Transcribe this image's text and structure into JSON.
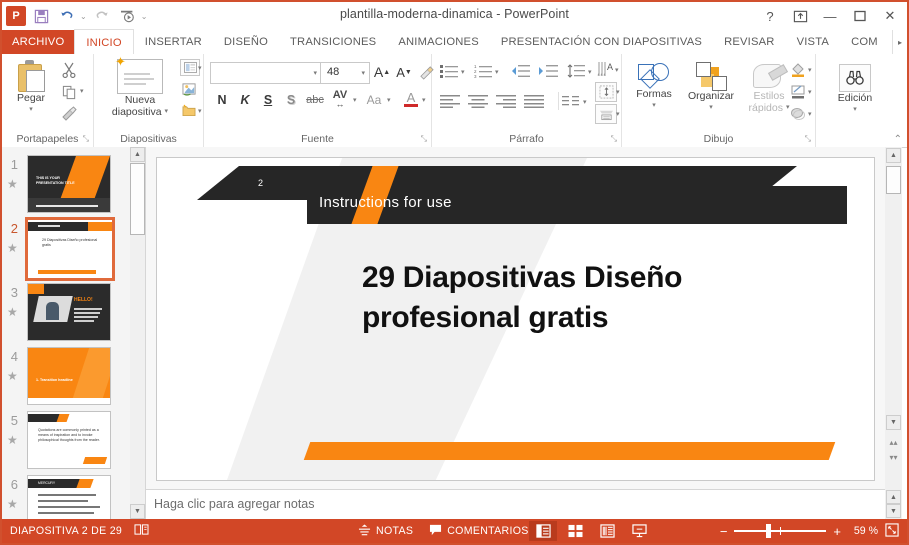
{
  "window": {
    "title": "plantilla-moderna-dinamica - PowerPoint",
    "logo": "P",
    "help_icon": "?",
    "ribbon_options_icon": "ribbon-display-options-icon",
    "minimize_icon": "—",
    "maximize_icon": "❐",
    "close_icon": "✕"
  },
  "quick_access": {
    "save_icon": "💾",
    "undo_icon": "↶",
    "redo_icon": "↻",
    "slideshow_icon": "▶",
    "customize_icon": "⌄"
  },
  "tabs": [
    {
      "label": "ARCHIVO",
      "kind": "file"
    },
    {
      "label": "INICIO",
      "kind": "active"
    },
    {
      "label": "INSERTAR",
      "kind": "normal"
    },
    {
      "label": "DISEÑO",
      "kind": "normal"
    },
    {
      "label": "TRANSICIONES",
      "kind": "normal"
    },
    {
      "label": "ANIMACIONES",
      "kind": "normal"
    },
    {
      "label": "PRESENTACIÓN CON DIAPOSITIVAS",
      "kind": "normal"
    },
    {
      "label": "REVISAR",
      "kind": "normal"
    },
    {
      "label": "VISTA",
      "kind": "normal"
    },
    {
      "label": "COM",
      "kind": "normal"
    }
  ],
  "tab_overflow_icon": "▸",
  "ribbon": {
    "clipboard": {
      "group_label": "Portapapeles",
      "paste_label": "Pegar",
      "paste_caret": "▾",
      "cut_icon": "✂",
      "copy_icon": "❐",
      "copy_caret": "▾",
      "format_painter_icon": "🖌",
      "dialog_launcher": "⤡"
    },
    "slides": {
      "group_label": "Diapositivas",
      "new_slide_label": "Nueva\ndiapositiva",
      "new_slide_line1": "Nueva",
      "new_slide_line2": "diapositiva",
      "new_slide_caret": "▾",
      "layout_icon": "▤",
      "layout_caret": "▾",
      "reset_icon": "⟲",
      "section_icon": "▥",
      "section_caret": "▾"
    },
    "font": {
      "group_label": "Fuente",
      "font_name_value": "",
      "font_name_caret": "▾",
      "font_size_value": "48",
      "font_size_caret": "▾",
      "grow_font_icon": "A",
      "shrink_font_icon": "A",
      "clear_format_icon": "✐",
      "bold_label": "N",
      "italic_label": "K",
      "underline_label": "S",
      "shadow_label": "S",
      "strike_label": "abc",
      "spacing_label": "AV",
      "spacing_caret": "▾",
      "change_case_label": "Aa",
      "change_case_caret": "▾",
      "font_color_label": "A",
      "font_color_caret": "▾",
      "dialog_launcher": "⤡"
    },
    "paragraph": {
      "group_label": "Párrafo",
      "bullets_icon": "•≡",
      "bullets_caret": "▾",
      "numbering_icon": "1≡",
      "numbering_caret": "▾",
      "decrease_indent_icon": "←≡",
      "increase_indent_icon": "→≡",
      "line_spacing_icon": "↕≡",
      "line_spacing_caret": "▾",
      "align_left_icon": "≡",
      "align_center_icon": "≡",
      "align_right_icon": "≡",
      "justify_icon": "≡",
      "columns_icon": "≡",
      "columns_caret": "▾",
      "text_direction_icon": "A",
      "text_direction_caret": "▾",
      "align_text_icon": "⬍",
      "align_text_caret": "▾",
      "smartart_icon": "▦",
      "smartart_caret": "▾",
      "dialog_launcher": "⤡"
    },
    "drawing": {
      "group_label": "Dibujo",
      "shapes_label": "Formas",
      "shapes_caret": "▾",
      "arrange_label": "Organizar",
      "arrange_caret": "▾",
      "quick_styles_line1": "Estilos",
      "quick_styles_line2": "rápidos",
      "quick_styles_caret": "▾",
      "shape_fill_icon": "🪣",
      "shape_fill_caret": "▾",
      "shape_outline_icon": "✎",
      "shape_outline_caret": "▾",
      "shape_effects_icon": "◐",
      "shape_effects_caret": "▾",
      "dialog_launcher": "⤡"
    },
    "editing": {
      "group_label": "",
      "edit_label": "Edición",
      "edit_icon": "🔍",
      "edit_caret": "▾"
    },
    "collapse_icon": "⌃"
  },
  "thumbnails": {
    "scroll_up_icon": "▲",
    "scroll_down_icon": "▼",
    "animation_icon": "★",
    "slides": [
      {
        "number": "1",
        "selected": false,
        "style": "dark-title",
        "text": "THIS IS YOUR PRESENTATION TITLE"
      },
      {
        "number": "2",
        "selected": true,
        "style": "light-body",
        "text": "29 Diapositivas Diseño profesional gratis"
      },
      {
        "number": "3",
        "selected": false,
        "style": "dark-photo",
        "text": "HELLO!"
      },
      {
        "number": "4",
        "selected": false,
        "style": "orange-full",
        "text": "1. Transition headline"
      },
      {
        "number": "5",
        "selected": false,
        "style": "light-quote",
        "text": "Quotations are commonly printed as a means of inspiration and to invoke philosophical thoughts from the reader."
      },
      {
        "number": "6",
        "selected": false,
        "style": "light-list",
        "text": "MERCURY"
      }
    ]
  },
  "slide": {
    "number_badge": "2",
    "header_title": "Instructions for use",
    "body_text": "29 Diapositivas Diseño profesional gratis",
    "colors": {
      "orange": "#f98612",
      "dark": "#262626",
      "light_grey": "#f1f1f1"
    }
  },
  "notes": {
    "placeholder": "Haga clic para agregar notas",
    "scroll_up_icon": "▲",
    "scroll_down_icon": "▼"
  },
  "scrollbar": {
    "up_icon": "▲",
    "down_icon": "▼",
    "prev_slide_icon": "▴▴",
    "next_slide_icon": "▾▾"
  },
  "status_bar": {
    "slide_counter": "DIAPOSITIVA 2 DE 29",
    "language_icon": "📖",
    "notes_label": "NOTAS",
    "notes_icon": "☰",
    "comments_label": "COMENTARIOS",
    "comments_icon": "💬",
    "view_normal_icon": "▤",
    "view_sorter_icon": "▦",
    "view_reading_icon": "▥",
    "view_slideshow_icon": "⬓",
    "zoom_out_icon": "−",
    "zoom_in_icon": "+",
    "zoom_value": "59 %",
    "fit_window_icon": "⛶",
    "accent_color": "#d24726"
  }
}
